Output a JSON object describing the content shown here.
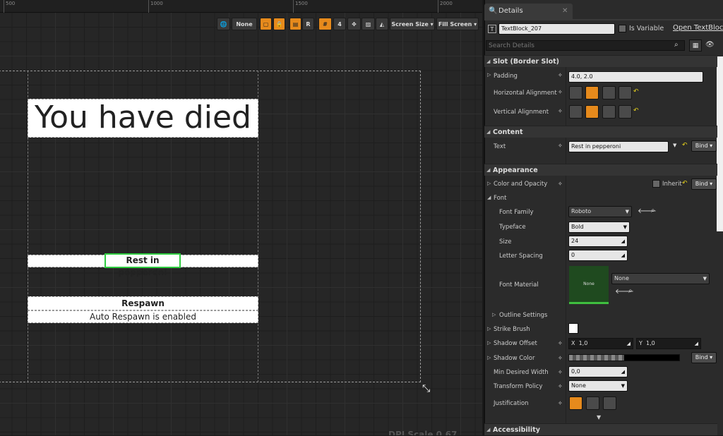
{
  "ruler": {
    "ticks": [
      "500",
      "1000",
      "1500",
      "2000"
    ]
  },
  "toolbar": {
    "none_label": "None",
    "r_label": "R",
    "grid_value": "4",
    "screen_size_label": "Screen Size",
    "fill_screen_label": "Fill Screen"
  },
  "canvas": {
    "title": "You have died",
    "subtitle": "Rest in pepperoni",
    "respawn": "Respawn",
    "auto_respawn": "Auto Respawn is enabled",
    "dpi_text": "DPI Scale 0.67"
  },
  "details": {
    "tab_label": "Details",
    "name_value": "TextBlock_207",
    "is_variable_label": "Is Variable",
    "open_textblock_label": "Open TextBlock",
    "search_placeholder": "Search Details",
    "sections": {
      "slot": "Slot (Border Slot)",
      "content": "Content",
      "appearance": "Appearance",
      "accessibility": "Accessibility"
    },
    "padding_label": "Padding",
    "padding_value": "4.0, 2.0",
    "h_align_label": "Horizontal Alignment",
    "v_align_label": "Vertical Alignment",
    "text_label": "Text",
    "text_value": "Rest in pepperoni",
    "bind_label": "Bind",
    "color_opacity_label": "Color and Opacity",
    "inherit_label": "Inherit",
    "font_label": "Font",
    "font_family_label": "Font Family",
    "font_family_value": "Roboto",
    "typeface_label": "Typeface",
    "typeface_value": "Bold",
    "size_label": "Size",
    "size_value": "24",
    "letter_spacing_label": "Letter Spacing",
    "letter_spacing_value": "0",
    "font_material_label": "Font Material",
    "font_material_thumb": "None",
    "font_material_value": "None",
    "outline_settings_label": "Outline Settings",
    "strike_brush_label": "Strike Brush",
    "shadow_offset_label": "Shadow Offset",
    "shadow_x_axis": "X",
    "shadow_x_value": "1,0",
    "shadow_y_axis": "Y",
    "shadow_y_value": "1,0",
    "shadow_color_label": "Shadow Color",
    "min_width_label": "Min Desired Width",
    "min_width_value": "0,0",
    "transform_policy_label": "Transform Policy",
    "transform_policy_value": "None",
    "justification_label": "Justification"
  },
  "colors": {
    "accent": "#e68a1c",
    "selection": "#2ecc40",
    "material": "#1f4a1f"
  }
}
